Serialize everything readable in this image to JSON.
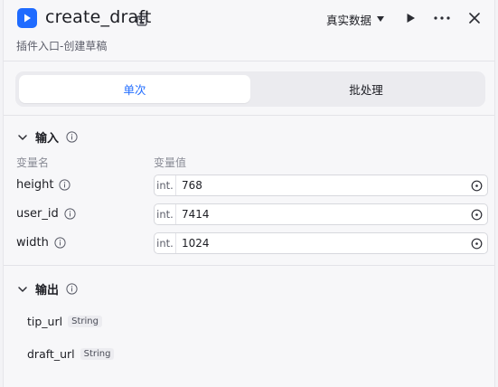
{
  "header": {
    "title": "create_draft",
    "subtitle": "插件入口-创建草稿",
    "dataset_label": "真实数据",
    "colors": {
      "brand": "#1f6bff"
    }
  },
  "tabs": [
    {
      "label": "单次",
      "active": true
    },
    {
      "label": "批处理",
      "active": false
    }
  ],
  "input": {
    "title": "输入",
    "col_name": "变量名",
    "col_value": "变量值",
    "params": [
      {
        "name": "height",
        "type": "int.",
        "value": "768"
      },
      {
        "name": "user_id",
        "type": "int.",
        "value": "7414"
      },
      {
        "name": "width",
        "type": "int.",
        "value": "1024"
      }
    ]
  },
  "output": {
    "title": "输出",
    "items": [
      {
        "name": "tip_url",
        "type": "String"
      },
      {
        "name": "draft_url",
        "type": "String"
      }
    ]
  }
}
